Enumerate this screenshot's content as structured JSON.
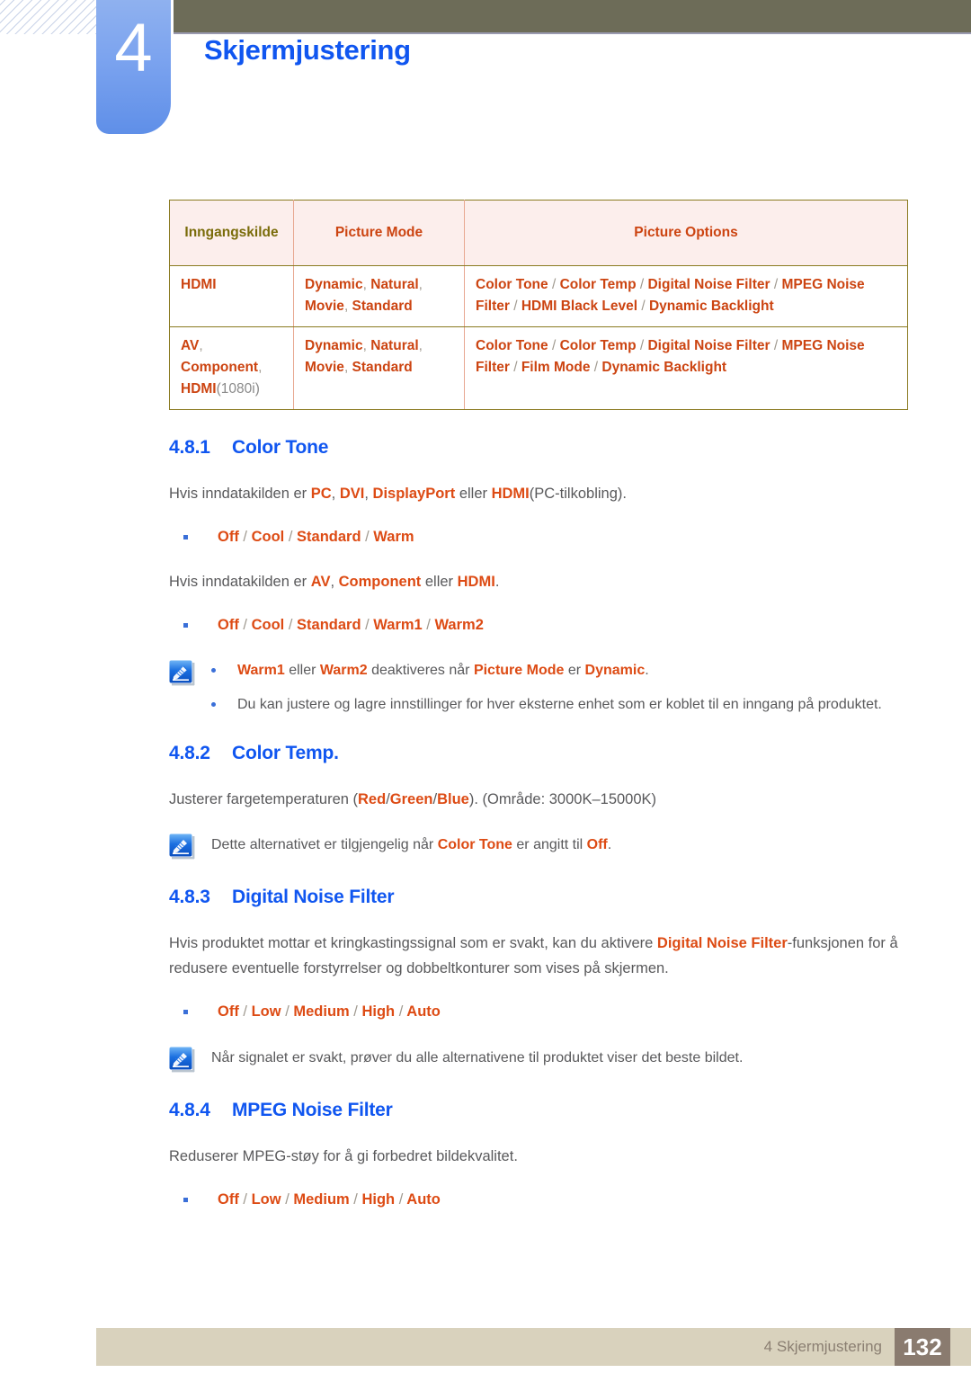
{
  "header": {
    "chapter_number": "4",
    "chapter_title": "Skjermjustering",
    "accent_blue": "#1056f0",
    "bar_olive": "#6d6c58"
  },
  "table": {
    "headers": {
      "source": "Inngangskilde",
      "picture_mode": "Picture Mode",
      "picture_options": "Picture Options"
    },
    "rows": [
      {
        "source": "HDMI",
        "source_suffix": "",
        "mode": "Dynamic, Natural, Movie, Standard",
        "options": "Color Tone / Color Temp / Digital Noise Filter / MPEG Noise Filter / HDMI Black Level / Dynamic Backlight"
      },
      {
        "source": "AV, Component, HDMI",
        "source_suffix": "(1080i)",
        "mode": "Dynamic, Natural, Movie, Standard",
        "options": "Color Tone / Color Temp / Digital Noise Filter / MPEG Noise Filter / Film Mode / Dynamic Backlight"
      }
    ]
  },
  "sections": {
    "s481": {
      "number": "4.8.1",
      "title": "Color Tone",
      "para1_a": "Hvis inndatakilden er ",
      "para1_pc": "PC",
      "para1_c1": ", ",
      "para1_dvi": "DVI",
      "para1_c2": ", ",
      "para1_dp": "DisplayPort",
      "para1_b": " eller ",
      "para1_hdmi": "HDMI",
      "para1_tail": "(PC-tilkobling).",
      "bullet1": "Off / Cool / Standard / Warm",
      "para2_a": "Hvis inndatakilden er ",
      "para2_av": "AV",
      "para2_c1": ", ",
      "para2_comp": "Component",
      "para2_b": " eller ",
      "para2_hdmi": "HDMI",
      "para2_tail": ".",
      "bullet2": "Off / Cool / Standard / Warm1 / Warm2",
      "note_icon": "note-pencil-icon",
      "note1_warm1": "Warm1",
      "note1_mid1": " eller ",
      "note1_warm2": "Warm2",
      "note1_mid2": " deaktiveres når ",
      "note1_pm": "Picture Mode",
      "note1_mid3": " er ",
      "note1_dyn": "Dynamic",
      "note1_tail": ".",
      "note2": "Du kan justere og lagre innstillinger for hver eksterne enhet som er koblet til en inngang på produktet."
    },
    "s482": {
      "number": "4.8.2",
      "title": "Color Temp.",
      "para_a": "Justerer fargetemperaturen (",
      "para_red": "Red",
      "para_s1": "/",
      "para_green": "Green",
      "para_s2": "/",
      "para_blue": "Blue",
      "para_tail": "). (Område: 3000K–15000K)",
      "note_icon": "note-pencil-icon",
      "note_a": "Dette alternativet er tilgjengelig når ",
      "note_ct": "Color Tone",
      "note_b": " er angitt til ",
      "note_off": "Off",
      "note_tail": "."
    },
    "s483": {
      "number": "4.8.3",
      "title": "Digital Noise Filter",
      "para_a": "Hvis produktet mottar et kringkastingssignal som er svakt, kan du aktivere ",
      "para_hl": "Digital Noise Filter",
      "para_b": "-funksjonen for å redusere eventuelle forstyrrelser og dobbeltkonturer som vises på skjermen.",
      "bullet": "Off / Low / Medium / High / Auto",
      "note_icon": "note-pencil-icon",
      "note": "Når signalet er svakt, prøver du alle alternativene til produktet viser det beste bildet."
    },
    "s484": {
      "number": "4.8.4",
      "title": "MPEG Noise Filter",
      "para": "Reduserer MPEG-støy for å gi forbedret bildekvalitet.",
      "bullet": "Off / Low / Medium / High / Auto"
    }
  },
  "footer": {
    "label": "4 Skjermjustering",
    "page": "132"
  }
}
